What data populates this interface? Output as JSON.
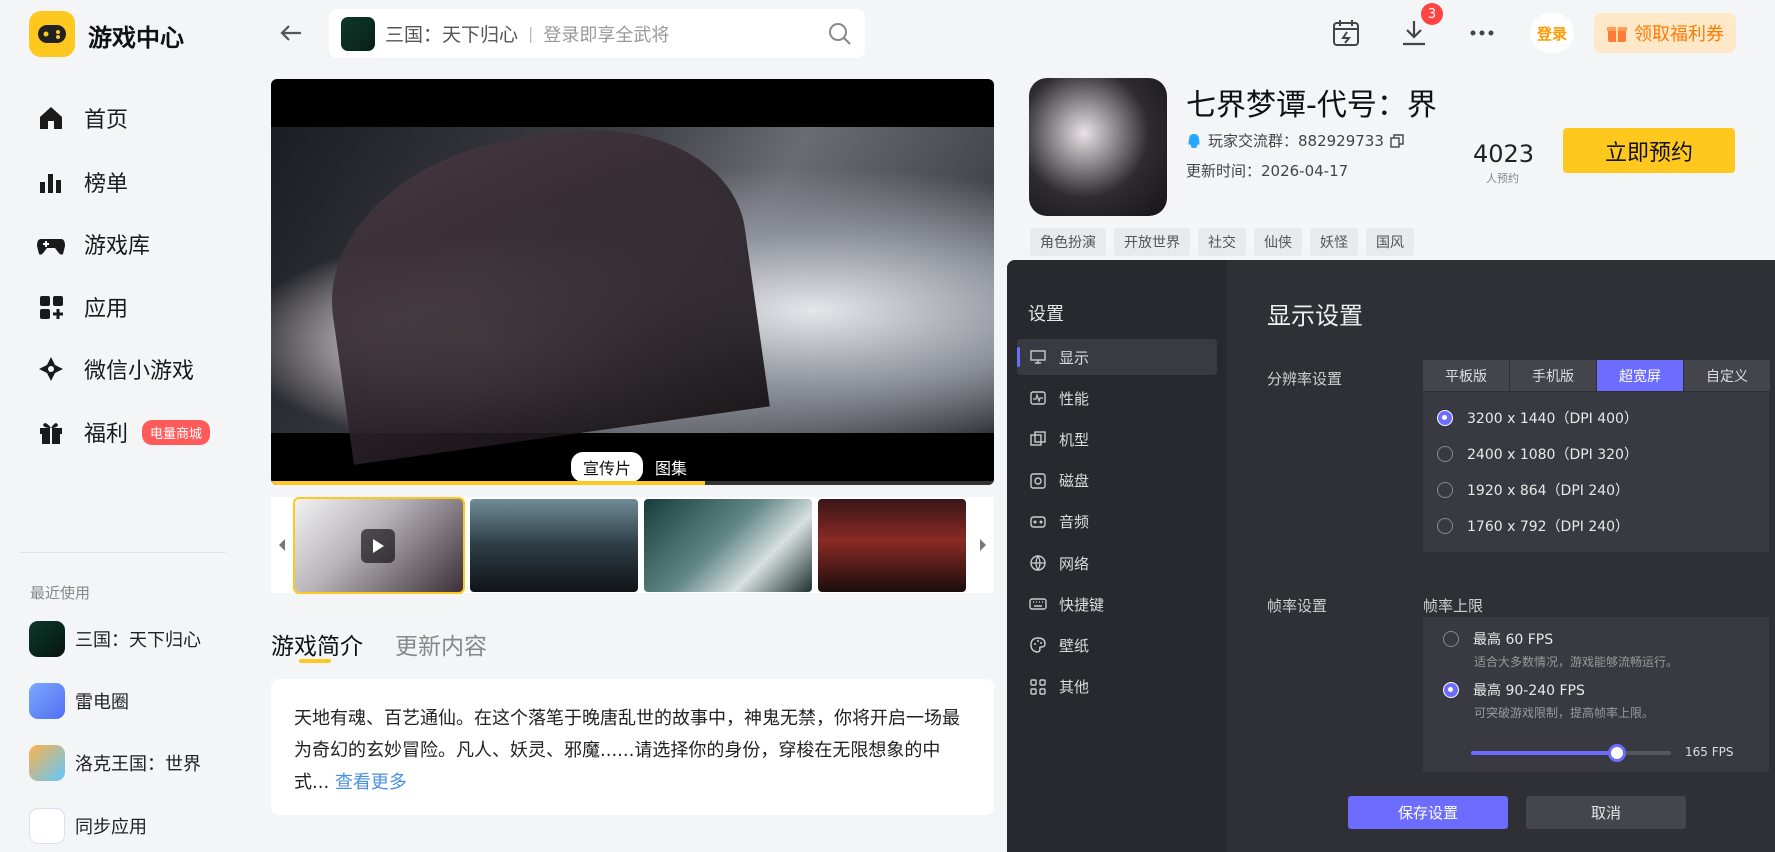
{
  "app": {
    "title": "游戏中心"
  },
  "nav": [
    {
      "label": "首页",
      "icon": "home-icon"
    },
    {
      "label": "榜单",
      "icon": "ranking-icon"
    },
    {
      "label": "游戏库",
      "icon": "gamepad-icon"
    },
    {
      "label": "应用",
      "icon": "apps-icon"
    },
    {
      "label": "微信小游戏",
      "icon": "mini-game-icon"
    },
    {
      "label": "福利",
      "icon": "gift-icon",
      "badge": "电量商城"
    }
  ],
  "recent": {
    "title": "最近使用",
    "items": [
      {
        "label": "三国：天下归心"
      },
      {
        "label": "雷电圈"
      },
      {
        "label": "洛克王国：世界"
      },
      {
        "label": "同步应用"
      }
    ]
  },
  "search": {
    "game": "三国：天下归心",
    "placeholder": "登录即享全武将"
  },
  "toolbar": {
    "download_count": "3",
    "login": "登录",
    "coupon": "领取福利券"
  },
  "video": {
    "tab_trailer": "宣传片",
    "tab_gallery": "图集",
    "progress": 0.6
  },
  "tabs": {
    "intro": "游戏简介",
    "update": "更新内容"
  },
  "description": {
    "text": "天地有魂、百艺通仙。在这个落笔于晚唐乱世的故事中，神鬼无禁，你将开启一场最为奇幻的玄妙冒险。凡人、妖灵、邪魔......请选择你的身份，穿梭在无限想象的中式...",
    "more": "查看更多"
  },
  "game": {
    "title": "七界梦谭-代号：界",
    "qq_group": "玩家交流群：882929733",
    "update_date": "更新时间：2026-04-17",
    "reserve_count": "4023",
    "reserve_label": "人预约",
    "reserve_button": "立即预约",
    "tags": [
      "角色扮演",
      "开放世界",
      "社交",
      "仙侠",
      "妖怪",
      "国风"
    ]
  },
  "settings": {
    "title": "设置",
    "menu": [
      {
        "label": "显示",
        "icon": "monitor-icon"
      },
      {
        "label": "性能",
        "icon": "performance-icon"
      },
      {
        "label": "机型",
        "icon": "device-icon"
      },
      {
        "label": "磁盘",
        "icon": "disk-icon"
      },
      {
        "label": "音频",
        "icon": "audio-icon"
      },
      {
        "label": "网络",
        "icon": "globe-icon"
      },
      {
        "label": "快捷键",
        "icon": "keyboard-icon"
      },
      {
        "label": "壁纸",
        "icon": "palette-icon"
      },
      {
        "label": "其他",
        "icon": "more-grid-icon"
      }
    ],
    "display_title": "显示设置",
    "resolution_label": "分辨率设置",
    "modes": [
      "平板版",
      "手机版",
      "超宽屏",
      "自定义"
    ],
    "active_mode": "超宽屏",
    "resolutions": [
      "3200 x 1440（DPI 400）",
      "2400 x 1080（DPI 320）",
      "1920 x 864（DPI 240）",
      "1760 x 792（DPI 240）"
    ],
    "selected_resolution": 0,
    "fps_label": "帧率设置",
    "fps_limit_label": "帧率上限",
    "fps_options": [
      {
        "title": "最高 60 FPS",
        "desc": "适合大多数情况，游戏能够流畅运行。"
      },
      {
        "title": "最高 90-240 FPS",
        "desc": "可突破游戏限制，提高帧率上限。"
      }
    ],
    "selected_fps": 1,
    "fps_value": "165 FPS",
    "fps_slider_fraction": 0.73,
    "save": "保存设置",
    "cancel": "取消"
  },
  "colors": {
    "accent": "#ffc81e",
    "dialog_accent": "#6c6cff",
    "link": "#4a90e2"
  }
}
